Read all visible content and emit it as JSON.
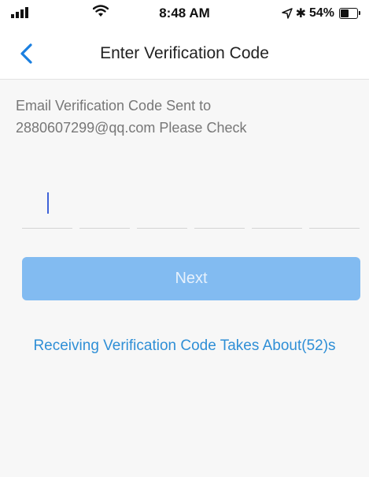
{
  "status_bar": {
    "time": "8:48 AM",
    "battery_text": "54%",
    "battery_level": 0.54,
    "icons": [
      "signal-icon",
      "wifi-icon",
      "location-icon",
      "bluetooth-icon",
      "battery-icon"
    ]
  },
  "nav": {
    "back_icon": "chevron-left-icon",
    "title": "Enter Verification Code",
    "accent": "#1a7fe0"
  },
  "hint": {
    "line1": "Email Verification Code Sent to",
    "line2": "2880607299@qq.com Please Check"
  },
  "code": {
    "length": 6,
    "digits": [
      "",
      "",
      "",
      "",
      "",
      ""
    ]
  },
  "next_button": {
    "label": "Next",
    "color": "#82bbf1",
    "enabled": false
  },
  "resend": {
    "text": "Receiving Verification Code Takes About(52)s",
    "color": "#2f8fd6"
  }
}
